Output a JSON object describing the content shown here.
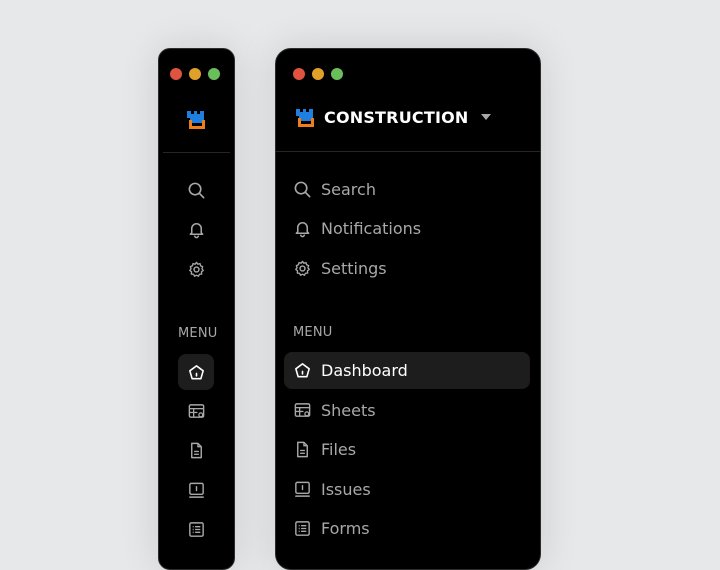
{
  "brand": {
    "name": "CONSTRUCTION"
  },
  "window": {
    "controls": [
      "close",
      "minimize",
      "maximize"
    ]
  },
  "top_nav": [
    {
      "label": "Search",
      "icon": "search-icon"
    },
    {
      "label": "Notifications",
      "icon": "bell-icon"
    },
    {
      "label": "Settings",
      "icon": "gear-icon"
    }
  ],
  "menu": {
    "heading": "MENU",
    "items": [
      {
        "label": "Dashboard",
        "icon": "home-icon",
        "active": true
      },
      {
        "label": "Sheets",
        "icon": "sheets-icon",
        "active": false
      },
      {
        "label": "Files",
        "icon": "file-icon",
        "active": false
      },
      {
        "label": "Issues",
        "icon": "issues-icon",
        "active": false
      },
      {
        "label": "Forms",
        "icon": "forms-icon",
        "active": false
      }
    ]
  },
  "colors": {
    "background": "#e7e8ea",
    "panel": "#000000",
    "active_item": "#1d1d1d",
    "text_muted": "#a8a8a8",
    "text_active": "#ffffff",
    "close": "#e0533f",
    "minimize": "#e0a12b",
    "maximize": "#6bbf5a",
    "logo_blue": "#1f7fe0",
    "logo_orange": "#f07d1b"
  }
}
